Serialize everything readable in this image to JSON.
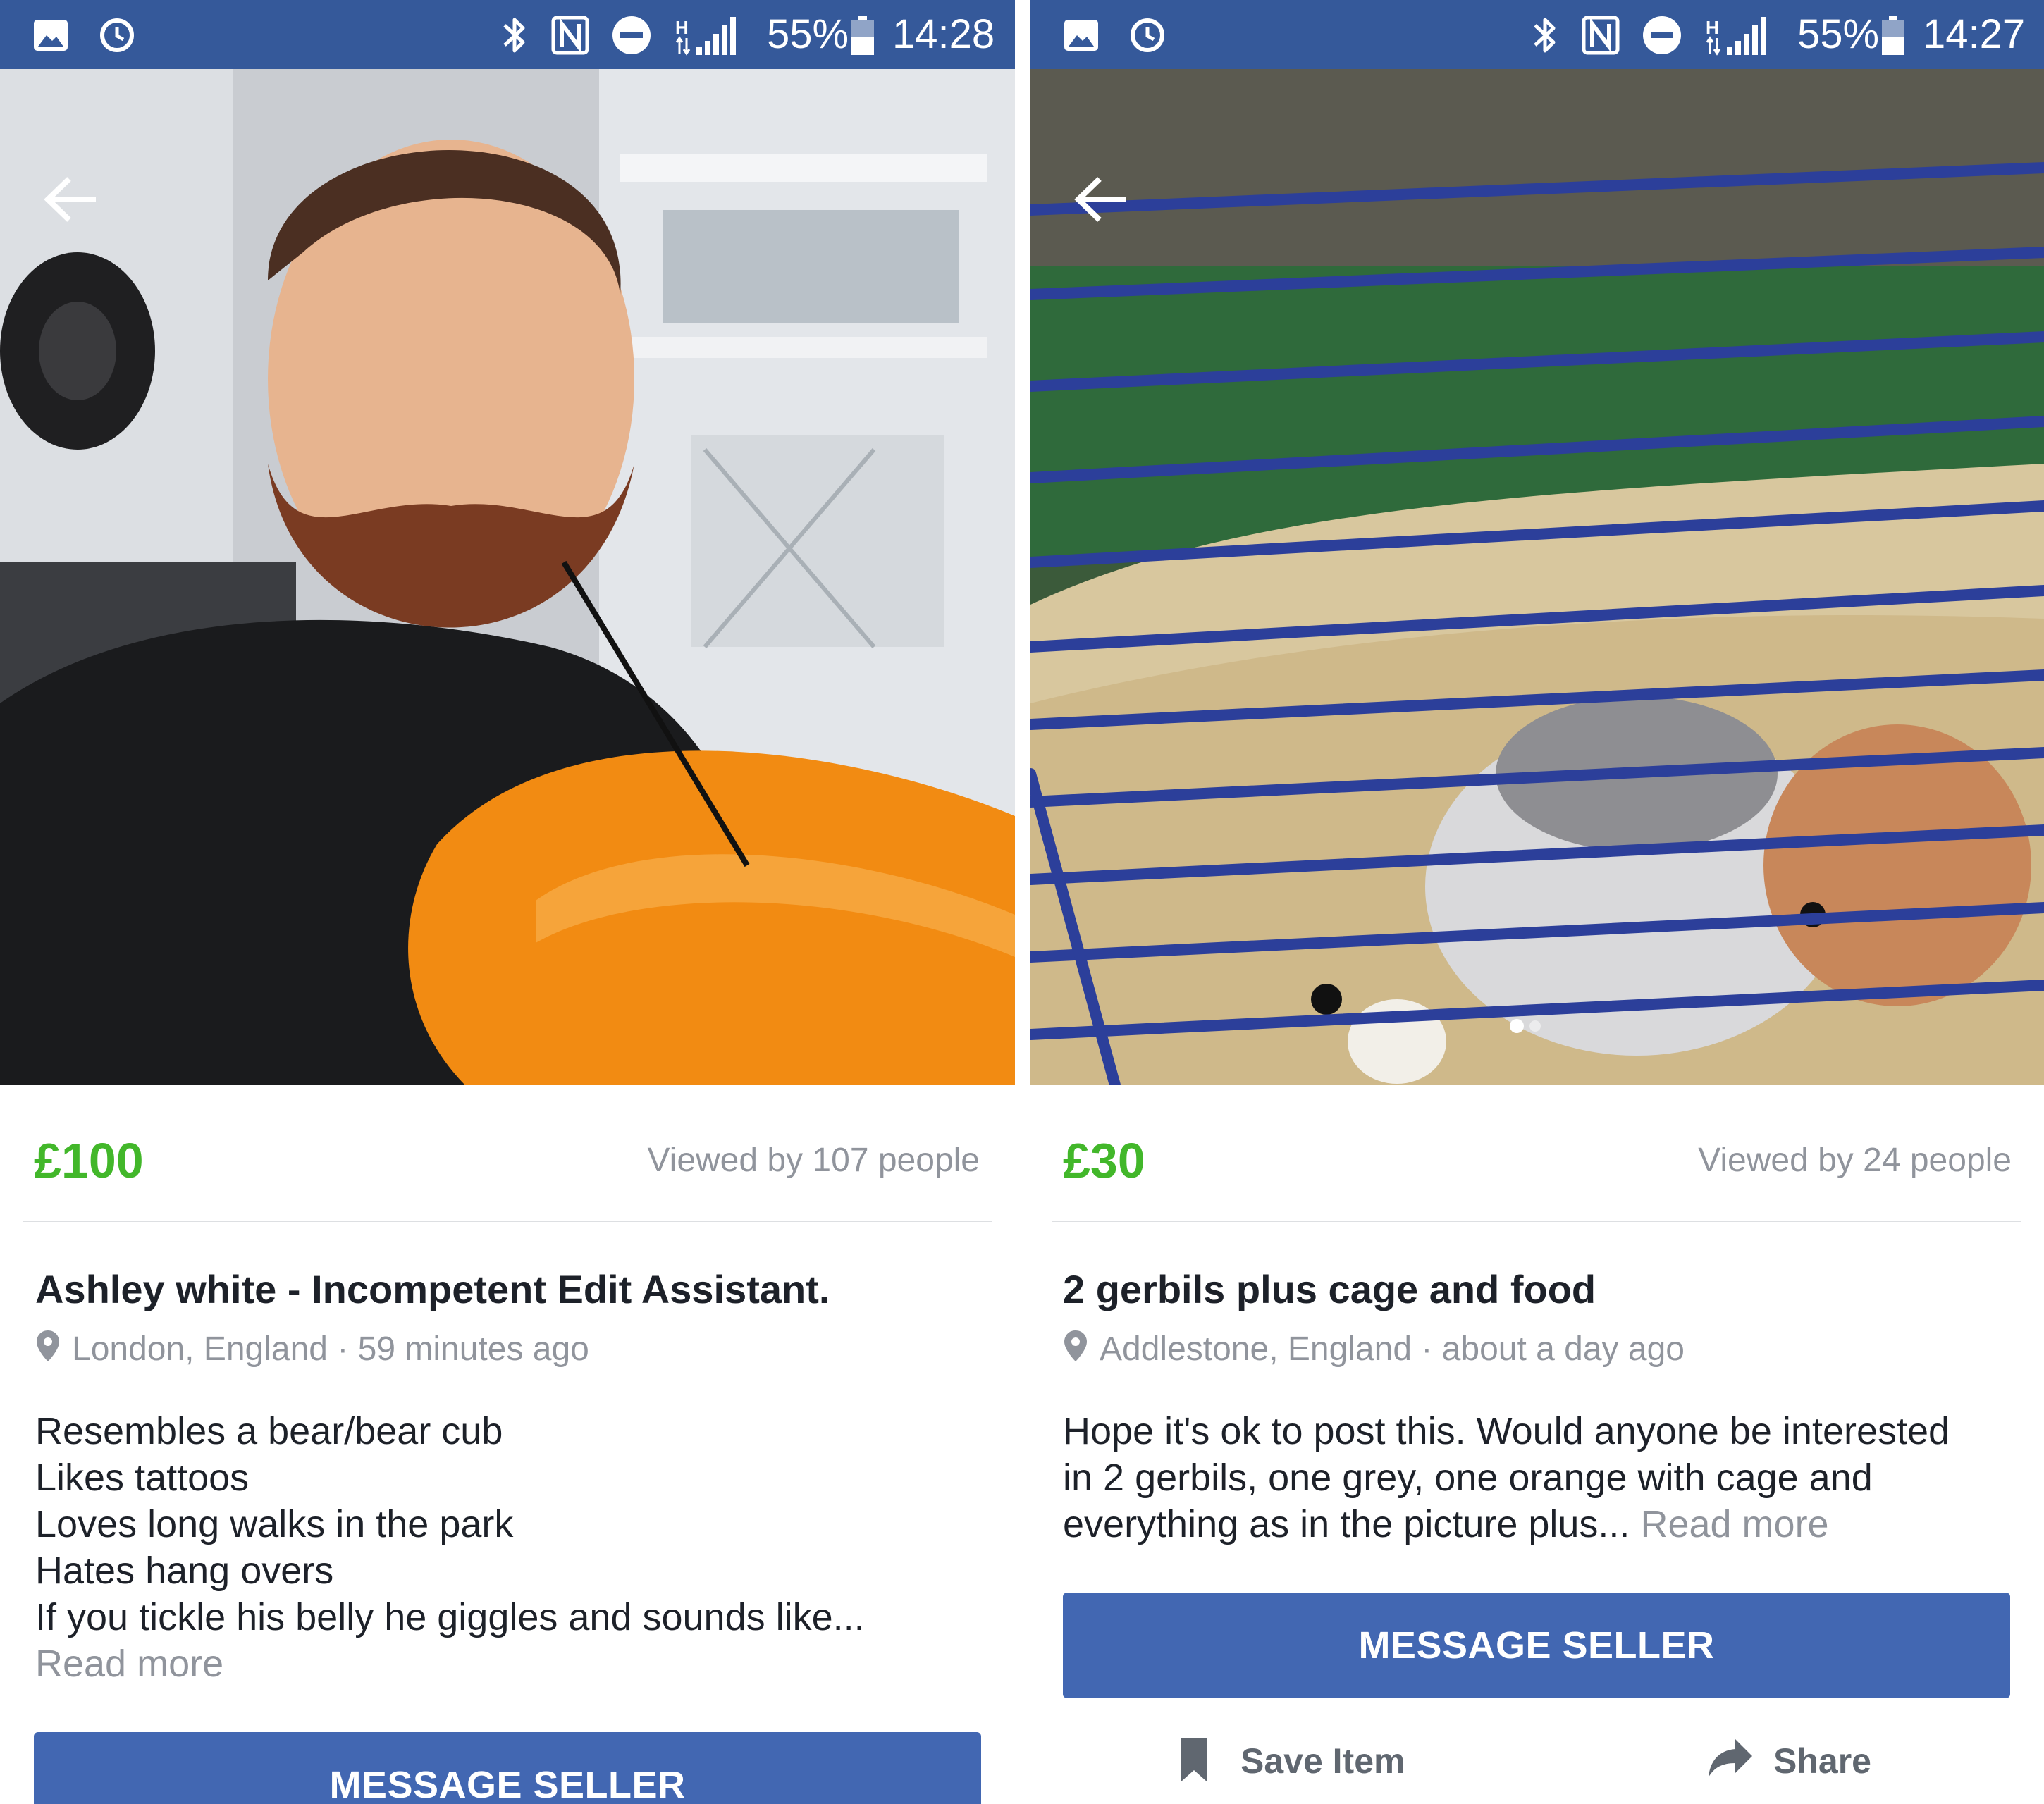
{
  "left": {
    "status_bar": {
      "battery": "55%",
      "time": "14:28"
    },
    "listing": {
      "price": "£100",
      "views": "Viewed by 107 people",
      "title": "Ashley white - Incompetent Edit Assistant.",
      "location": "London, England · 59 minutes ago",
      "description_lines": [
        "Resembles a bear/bear cub",
        "Likes tattoos",
        "Loves long walks in the park",
        "Hates hang overs",
        "If you tickle his belly he giggles and sounds like..."
      ],
      "read_more": "Read more",
      "message_button": "MESSAGE SELLER"
    }
  },
  "right": {
    "status_bar": {
      "battery": "55%",
      "time": "14:27"
    },
    "listing": {
      "price": "£30",
      "views": "Viewed by 24 people",
      "title": "2 gerbils plus cage and food",
      "location": "Addlestone, England · about a day ago",
      "description_lines": [
        "Hope it's ok to post this. Would anyone be interested",
        "in 2 gerbils, one grey, one orange with cage and",
        "everything as in the picture plus..."
      ],
      "read_more": "Read more",
      "message_button": "MESSAGE SELLER",
      "actions": {
        "save": "Save Item",
        "share": "Share"
      }
    }
  },
  "colors": {
    "status_bar": "#35599a",
    "price": "#42b72a",
    "button": "#4267b2",
    "muted_text": "#90949c",
    "body_text": "#1d2129"
  },
  "icons": [
    "image-icon",
    "alarm-icon",
    "bluetooth-icon",
    "nfc-icon",
    "do-not-disturb-icon",
    "signal-icon",
    "battery-icon",
    "back-arrow-icon",
    "location-pin-icon",
    "bookmark-icon",
    "share-arrow-icon"
  ]
}
